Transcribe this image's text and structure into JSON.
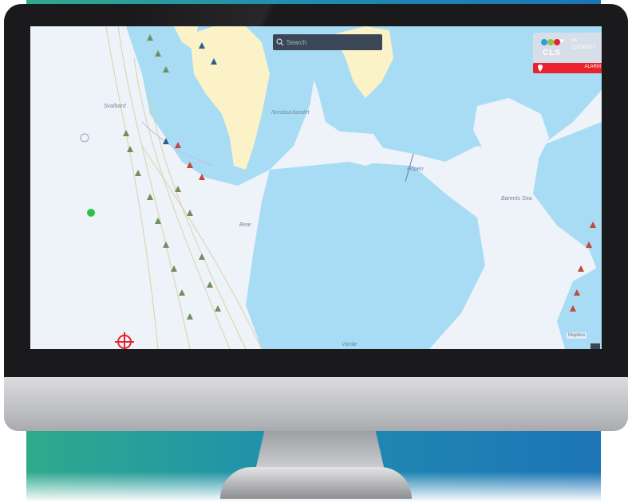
{
  "screen": {
    "search": {
      "placeholder": "Search"
    },
    "branding": {
      "logo_text": "CLS",
      "small_label_1": "cls",
      "small_label_2": "22/10/2020"
    },
    "alert": {
      "text": "ALARM"
    },
    "map": {
      "place_labels": [
        "Svalbard",
        "Nordaustlandet",
        "Hopen",
        "Barents Sea",
        "Bear",
        "Vardø"
      ],
      "corner_label": "Mapbox"
    },
    "colors": {
      "land": "#fbf3c7",
      "shallow_water": "#a8dcf5",
      "open_sea": "#eef2f9",
      "vessel_track": "#d9d2a6",
      "alert": "#e8232d",
      "frame": "#1a1a1c"
    }
  }
}
